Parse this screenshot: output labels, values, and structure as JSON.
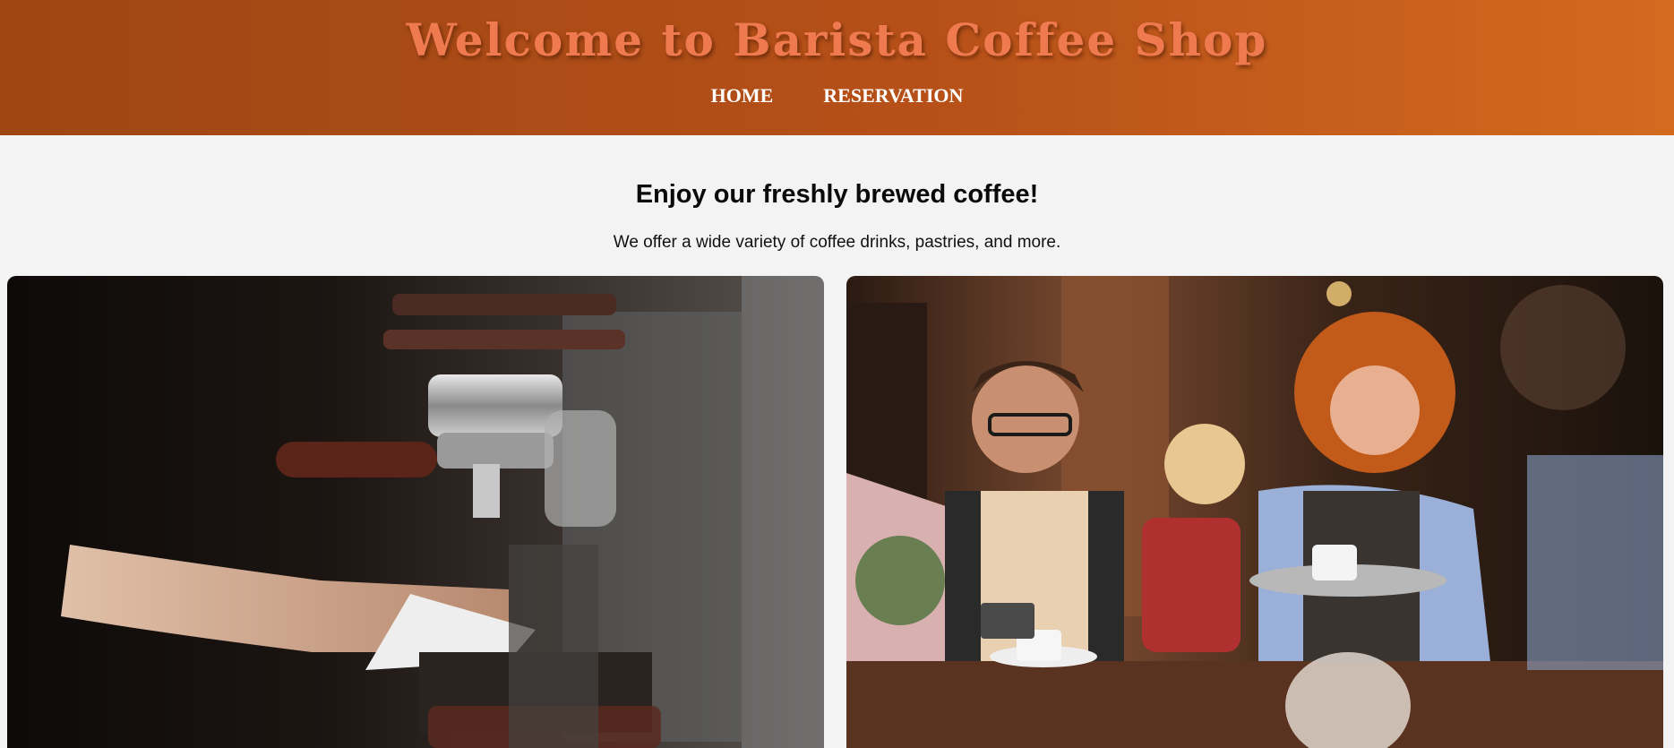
{
  "header": {
    "title": "Welcome to Barista Coffee Shop",
    "nav": [
      "HOME",
      "RESERVATION"
    ]
  },
  "intro": {
    "heading": "Enjoy our freshly brewed coffee!",
    "text": "We offer a wide variety of coffee drinks, pastries, and more."
  },
  "colors": {
    "header_gradient_start": "#9e4614",
    "header_gradient_end": "#d36a20",
    "title_color": "#ef7a50",
    "page_background": "#f3f3f3"
  }
}
